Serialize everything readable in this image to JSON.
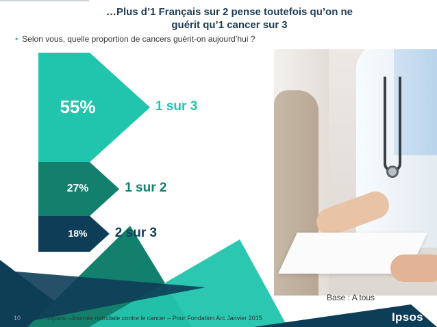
{
  "slide": {
    "title_line1": "…Plus d’1 Français sur 2 pense toutefois qu’on ne",
    "title_line2": "guérit qu’1 cancer sur 3",
    "question_bullet": "•",
    "question": "Selon vous, quelle proportion de cancers guérit-on aujourd’hui ?",
    "base": "Base : A tous",
    "page_number": "10",
    "footer": "©Ipsos –Journée mondiale contre le cancer – Pour Fondation Arc  Janvier 2015",
    "logo": "Ipsos"
  },
  "colors": {
    "series": [
      "#21c4ad",
      "#137f6d",
      "#0e3d57"
    ],
    "labels": [
      "#21c4ad",
      "#137f6d",
      "#0e3d57"
    ],
    "title": "#1b3b55",
    "accent_dark": "#0e3d57"
  },
  "chart_data": {
    "type": "bar",
    "categories": [
      "1 sur 3",
      "1 sur 2",
      "2 sur 3"
    ],
    "values": [
      55,
      27,
      18
    ],
    "value_labels": [
      "55%",
      "27%",
      "18%"
    ],
    "unit": "%"
  }
}
